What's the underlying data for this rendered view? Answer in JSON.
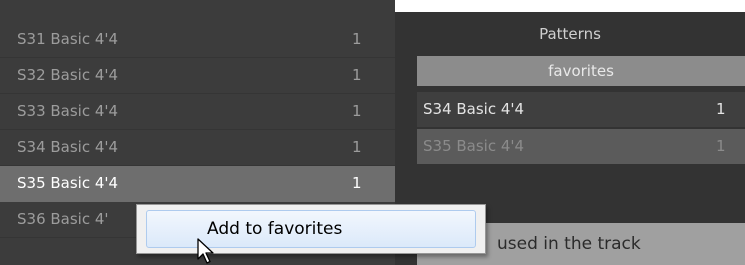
{
  "pattern_list": {
    "rows": [
      {
        "name": "S31 Basic 4'4",
        "count": "1",
        "selected": false
      },
      {
        "name": "S32 Basic 4'4",
        "count": "1",
        "selected": false
      },
      {
        "name": "S33 Basic 4'4",
        "count": "1",
        "selected": false
      },
      {
        "name": "S34 Basic 4'4",
        "count": "1",
        "selected": false
      },
      {
        "name": "S35 Basic 4'4",
        "count": "1",
        "selected": true
      },
      {
        "name": "S36 Basic 4'",
        "count": "",
        "selected": false
      }
    ]
  },
  "right_panel": {
    "title": "Patterns",
    "favorites_header": "favorites",
    "favorites": [
      {
        "name": "S34 Basic 4'4",
        "count": "1"
      },
      {
        "name": "S35 Basic 4'4",
        "count": "1"
      }
    ],
    "used_header": "used in the track"
  },
  "context_menu": {
    "items": [
      {
        "label": "Add to favorites"
      }
    ]
  },
  "cursor": {
    "icon": "mouse-pointer-icon"
  },
  "colors": {
    "list_bg": "#3c3c3c",
    "selected_row_bg": "#6e6e6e",
    "header_bg": "#8c8c8c",
    "menu_bg": "#f0f0f0",
    "menu_highlight": "#dbe9fa"
  }
}
